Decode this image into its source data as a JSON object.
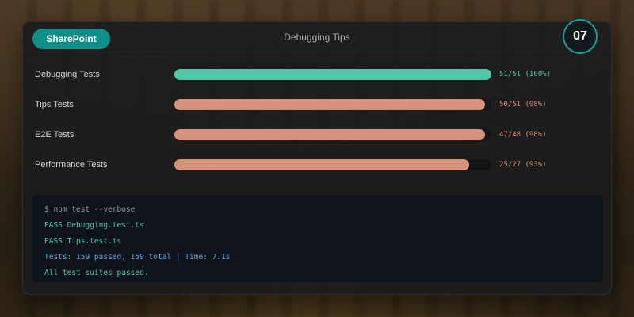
{
  "header": {
    "app_name": "SharePoint",
    "title": "Debugging Tips",
    "step_number": "07"
  },
  "colors": {
    "accent_teal": "#0f8f8a",
    "pass_green": "#50c8a8",
    "partial_salmon": "#d4937a",
    "console_info_blue": "#5aa8e0"
  },
  "test_suites": [
    {
      "label": "Debugging Tests",
      "stat": "51/51 (100%)",
      "progress": 1.0,
      "status": "pass"
    },
    {
      "label": "Tips Tests",
      "stat": "50/51 (98%)",
      "progress": 0.98,
      "status": "partial"
    },
    {
      "label": "E2E Tests",
      "stat": "47/48 (98%)",
      "progress": 0.98,
      "status": "partial"
    },
    {
      "label": "Performance Tests",
      "stat": "25/27 (93%)",
      "progress": 0.93,
      "status": "partial"
    }
  ],
  "console": {
    "lines": [
      {
        "text": "$ npm test --verbose",
        "kind": "command"
      },
      {
        "text": "PASS Debugging.test.ts",
        "kind": "pass"
      },
      {
        "text": "PASS Tips.test.ts",
        "kind": "pass"
      },
      {
        "text": "Tests: 159 passed, 159 total | Time: 7.1s",
        "kind": "info"
      },
      {
        "text": "All test suites passed.",
        "kind": "pass"
      }
    ]
  }
}
